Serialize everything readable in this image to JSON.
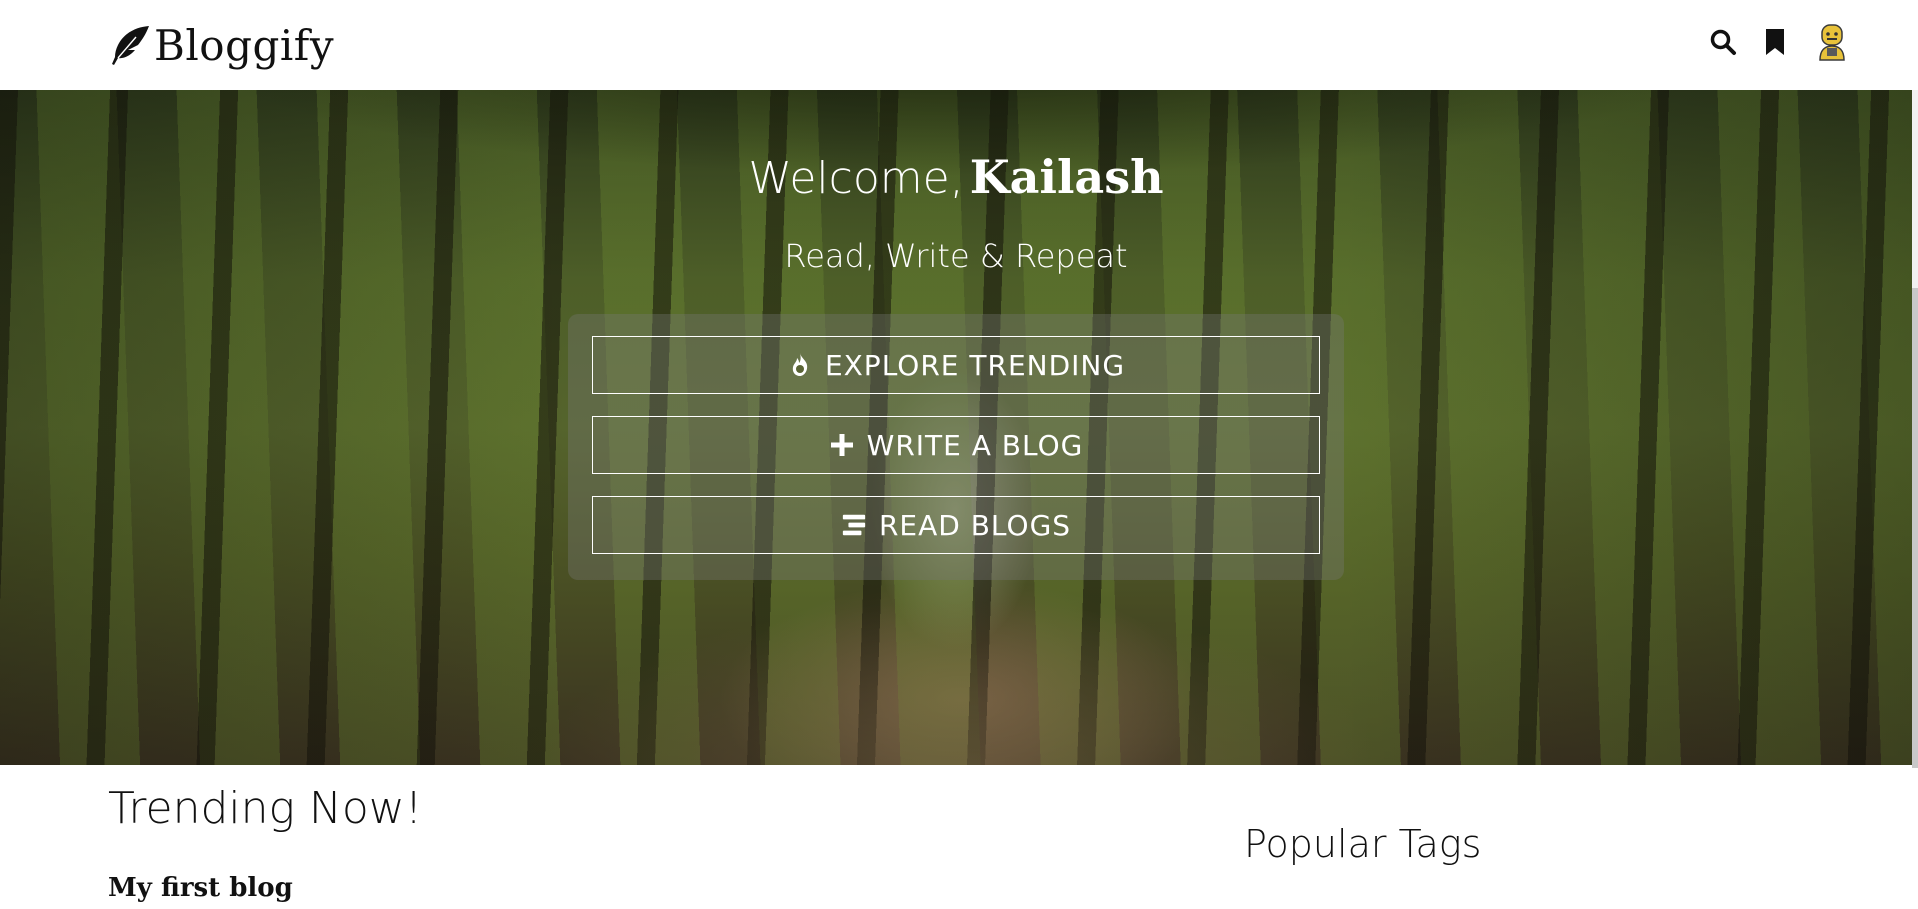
{
  "brand": {
    "name": "Bloggify"
  },
  "header": {
    "icons": [
      "search-icon",
      "bookmark-icon",
      "user-avatar"
    ]
  },
  "hero": {
    "welcome_word": "Welcome,",
    "user_name": "Kailash",
    "tagline": "Read, Write & Repeat",
    "actions": [
      {
        "label": "EXPLORE TRENDING",
        "icon": "fire-icon"
      },
      {
        "label": "WRITE A BLOG",
        "icon": "plus-icon"
      },
      {
        "label": "READ BLOGS",
        "icon": "list-icon"
      }
    ]
  },
  "trending": {
    "title": "Trending Now!",
    "first_blog_title": "My first blog"
  },
  "sidebar": {
    "popular_tags_title": "Popular Tags"
  },
  "colors": {
    "header_bg": "#ffffff",
    "text": "#111111",
    "hero_text": "#ffffff"
  }
}
